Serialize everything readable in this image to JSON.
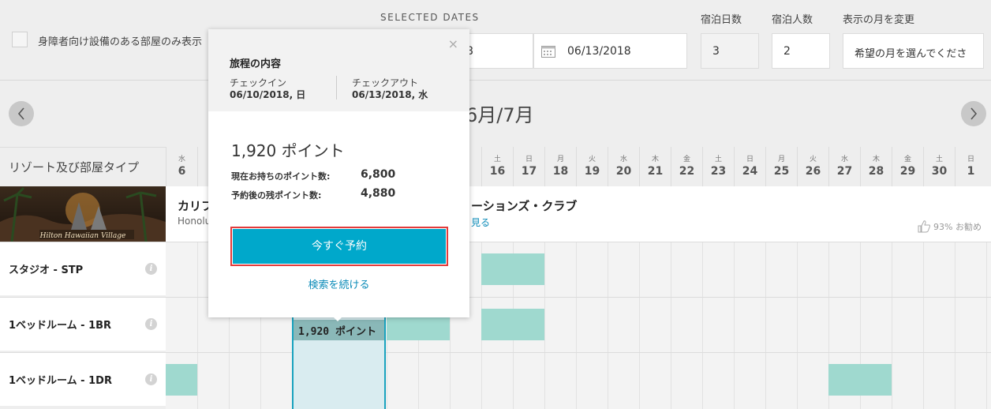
{
  "header": {
    "accessible_label": "身障者向け設備のある部屋のみ表示",
    "selected_dates_label": "SELECTED DATES",
    "checkin_field_value": "8",
    "checkout_field_value": "06/13/2018",
    "nights_label": "宿泊日数",
    "nights_value": "3",
    "guests_label": "宿泊人数",
    "guests_value": "2",
    "month_label": "表示の月を変更",
    "month_placeholder": "希望の月を選んでくださ"
  },
  "calendar": {
    "month_title": "6月/7月",
    "resort_header": "リゾート及び部屋タイプ",
    "days": [
      {
        "dow": "水",
        "day": "6"
      },
      {
        "dow": "",
        "day": ""
      },
      {
        "dow": "",
        "day": ""
      },
      {
        "dow": "",
        "day": ""
      },
      {
        "dow": "",
        "day": ""
      },
      {
        "dow": "",
        "day": ""
      },
      {
        "dow": "",
        "day": ""
      },
      {
        "dow": "",
        "day": ""
      },
      {
        "dow": "",
        "day": ""
      },
      {
        "dow": "",
        "day": "5"
      },
      {
        "dow": "土",
        "day": "16"
      },
      {
        "dow": "日",
        "day": "17"
      },
      {
        "dow": "月",
        "day": "18"
      },
      {
        "dow": "火",
        "day": "19"
      },
      {
        "dow": "水",
        "day": "20"
      },
      {
        "dow": "木",
        "day": "21"
      },
      {
        "dow": "金",
        "day": "22"
      },
      {
        "dow": "土",
        "day": "23"
      },
      {
        "dow": "日",
        "day": "24"
      },
      {
        "dow": "月",
        "day": "25"
      },
      {
        "dow": "火",
        "day": "26"
      },
      {
        "dow": "水",
        "day": "27"
      },
      {
        "dow": "木",
        "day": "28"
      },
      {
        "dow": "金",
        "day": "29"
      },
      {
        "dow": "土",
        "day": "30"
      },
      {
        "dow": "日",
        "day": "1"
      }
    ]
  },
  "resort": {
    "image_text": "Hilton Hawaiian Village",
    "name_visible_start": "カリフ",
    "name_visible_end": "ーションズ・クラブ",
    "location": "Honolu",
    "link_fragment": "見る",
    "recommend": "93% お勧め"
  },
  "rooms": [
    {
      "name": "スタジオ - STP"
    },
    {
      "name": "1ベッドルーム - 1BR"
    },
    {
      "name": "1ベッドルーム - 1DR"
    }
  ],
  "selection_label": "1,920 ポイント",
  "popup": {
    "itinerary_title": "旅程の内容",
    "checkin_label": "チェックイン",
    "checkin_value": "06/10/2018, 日",
    "checkout_label": "チェックアウト",
    "checkout_value": "06/13/2018, 水",
    "points_title": "1,920 ポイント",
    "current_points_label": "現在お持ちのポイント数:",
    "current_points_value": "6,800",
    "remaining_points_label": "予約後の残ポイント数:",
    "remaining_points_value": "4,880",
    "book_button": "今すぐ予約",
    "continue_link": "検索を続ける",
    "close": "×"
  }
}
